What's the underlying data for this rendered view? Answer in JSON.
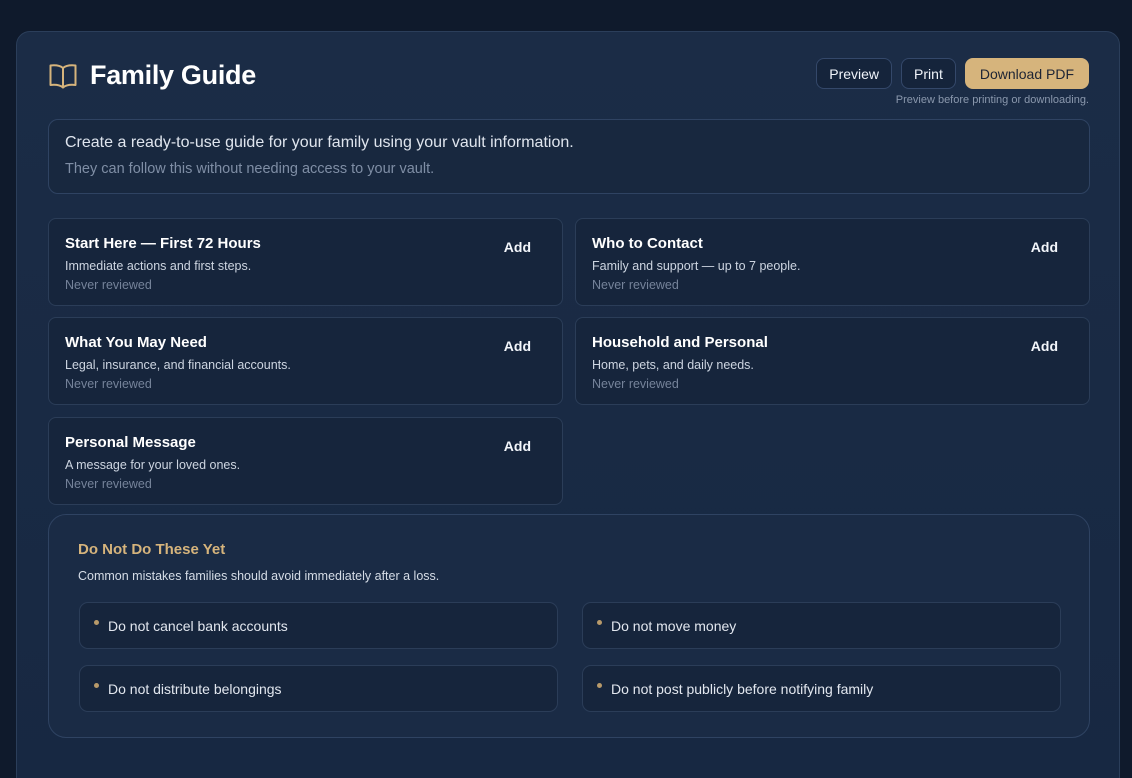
{
  "header": {
    "title": "Family Guide",
    "icon": "book-open-icon",
    "accent_color": "#d6b47c"
  },
  "actions": {
    "preview_label": "Preview",
    "print_label": "Print",
    "download_label": "Download PDF",
    "hint": "Preview before printing or downloading."
  },
  "intro": {
    "main": "Create a ready-to-use guide for your family using your vault information.",
    "sub": "They can follow this without needing access to your vault."
  },
  "sections": [
    {
      "title": "Start Here — First 72 Hours",
      "description": "Immediate actions and first steps.",
      "status": "Never reviewed",
      "action": "Add"
    },
    {
      "title": "Who to Contact",
      "description": "Family and support — up to 7 people.",
      "status": "Never reviewed",
      "action": "Add"
    },
    {
      "title": "What You May Need",
      "description": "Legal, insurance, and financial accounts.",
      "status": "Never reviewed",
      "action": "Add"
    },
    {
      "title": "Household and Personal",
      "description": "Home, pets, and daily needs.",
      "status": "Never reviewed",
      "action": "Add"
    },
    {
      "title": "Personal Message",
      "description": "A message for your loved ones.",
      "status": "Never reviewed",
      "action": "Add"
    }
  ],
  "warnings": {
    "title": "Do Not Do These Yet",
    "subtitle": "Common mistakes families should avoid immediately after a loss.",
    "items": [
      "Do not cancel bank accounts",
      "Do not move money",
      "Do not distribute belongings",
      "Do not post publicly before notifying family"
    ]
  }
}
